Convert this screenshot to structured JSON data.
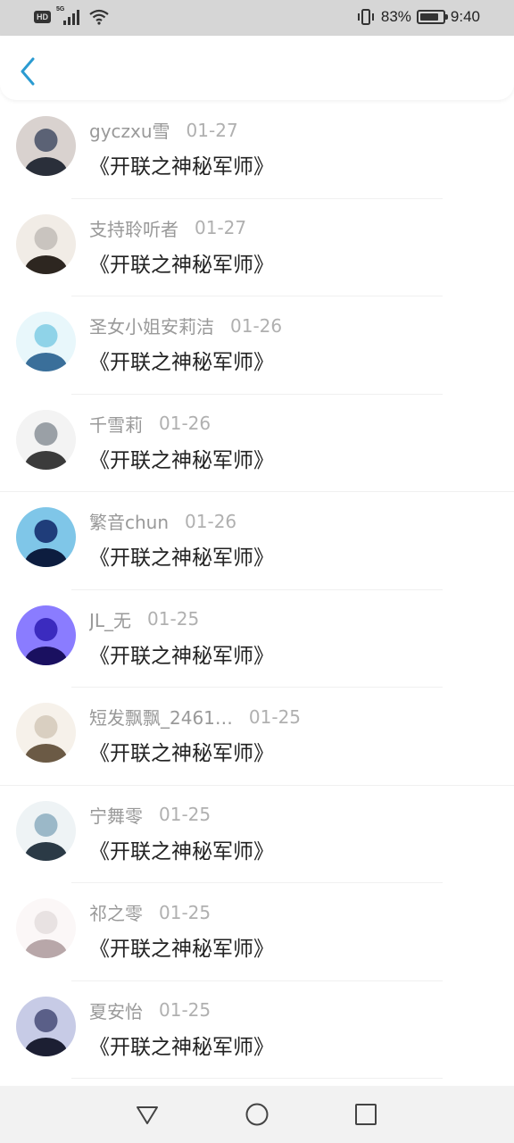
{
  "status_bar": {
    "hd_label": "HD",
    "network_label": "5G",
    "battery": "83%",
    "battery_level": 0.83,
    "time": "9:40"
  },
  "header": {
    "back_icon": "chevron-left-icon",
    "accent_color": "#2b9bd1"
  },
  "items": [
    {
      "username": "gyczxu雪",
      "date": "01-27",
      "comment": "《开联之神秘军师》"
    },
    {
      "username": "支持聆听者",
      "date": "01-27",
      "comment": "《开联之神秘军师》"
    },
    {
      "username": "圣女小姐安莉洁",
      "date": "01-26",
      "comment": "《开联之神秘军师》"
    },
    {
      "username": "千雪莉",
      "date": "01-26",
      "comment": "《开联之神秘军师》"
    },
    {
      "username": "繁音chun",
      "date": "01-26",
      "comment": "《开联之神秘军师》"
    },
    {
      "username": "JL_无",
      "date": "01-25",
      "comment": "《开联之神秘军师》"
    },
    {
      "username": "短发飘飘_2461…",
      "date": "01-25",
      "comment": "《开联之神秘军师》"
    },
    {
      "username": "宁舞零",
      "date": "01-25",
      "comment": "《开联之神秘军师》"
    },
    {
      "username": "祁之零",
      "date": "01-25",
      "comment": "《开联之神秘军师》"
    },
    {
      "username": "夏安怡",
      "date": "01-25",
      "comment": "《开联之神秘军师》"
    }
  ],
  "system_nav": {
    "back_icon": "triangle-back-icon",
    "home_icon": "circle-home-icon",
    "recents_icon": "square-recents-icon"
  }
}
